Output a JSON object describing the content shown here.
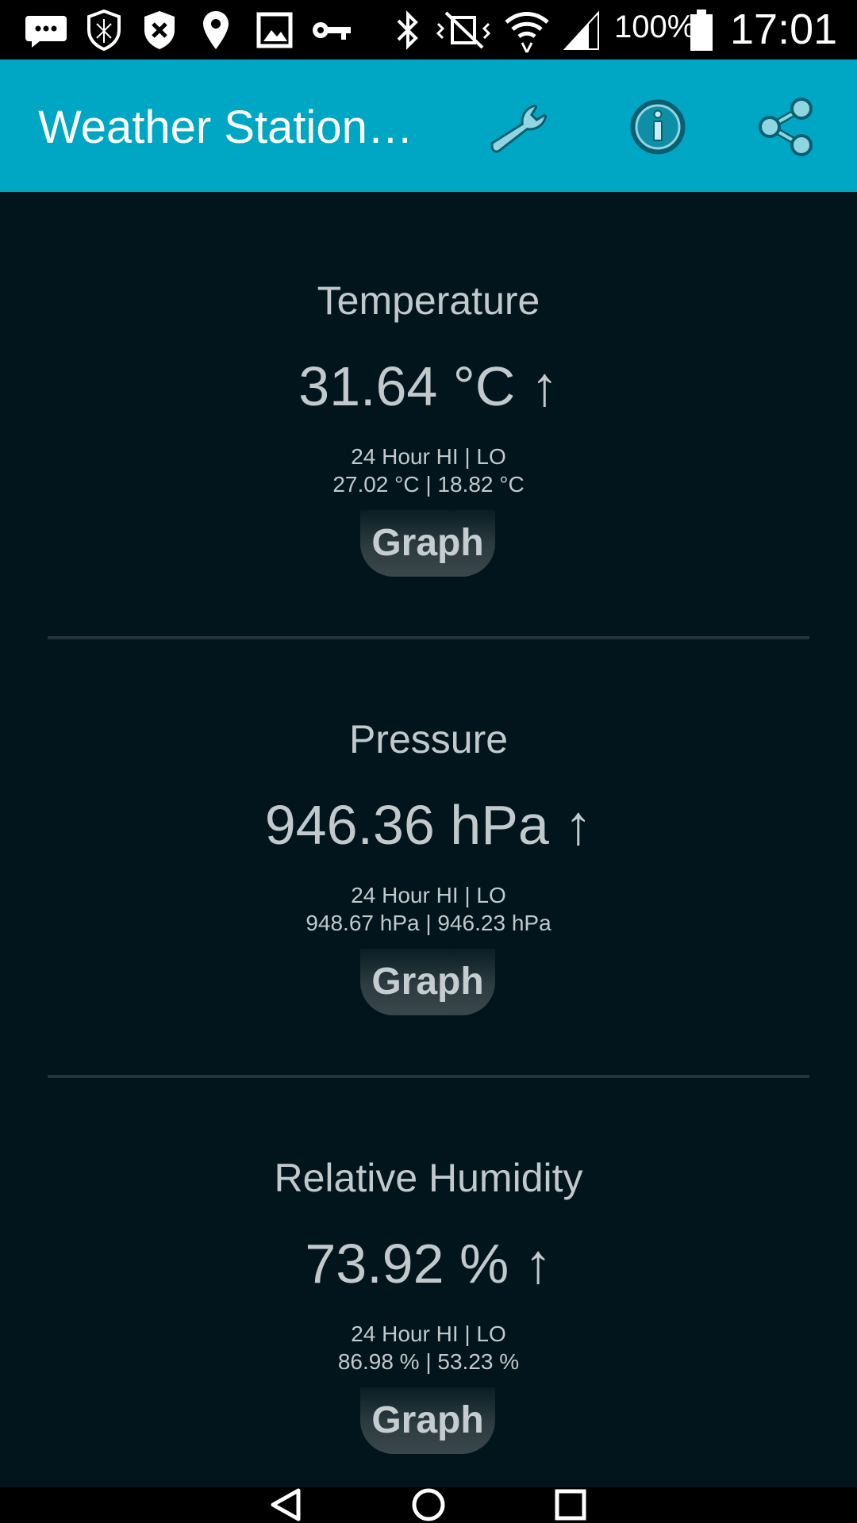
{
  "status_bar": {
    "battery": "100%",
    "time": "17:01",
    "icons": [
      "messages-icon",
      "shield-outline-icon",
      "shield-x-icon",
      "location-pin-icon",
      "image-icon",
      "key-icon",
      "bluetooth-icon",
      "vibrate-icon",
      "wifi-icon",
      "signal-icon",
      "battery-icon"
    ]
  },
  "app_bar": {
    "title": "Weather Station…",
    "actions": [
      "wrench-icon",
      "info-icon",
      "share-icon"
    ],
    "accent": "#00a7c4"
  },
  "sections": [
    {
      "title": "Temperature",
      "value": "31.64 °C ↑",
      "hilo_label": "24 Hour HI | LO",
      "hilo_values": "27.02 °C | 18.82 °C",
      "button": "Graph"
    },
    {
      "title": "Pressure",
      "value": "946.36 hPa ↑",
      "hilo_label": "24 Hour HI | LO",
      "hilo_values": "948.67 hPa | 946.23 hPa",
      "button": "Graph"
    },
    {
      "title": "Relative Humidity",
      "value": "73.92 % ↑",
      "hilo_label": "24 Hour HI | LO",
      "hilo_values": "86.98 % | 53.23 %",
      "button": "Graph"
    }
  ],
  "nav_bar": {
    "buttons": [
      "back-icon",
      "home-icon",
      "recents-icon"
    ]
  }
}
